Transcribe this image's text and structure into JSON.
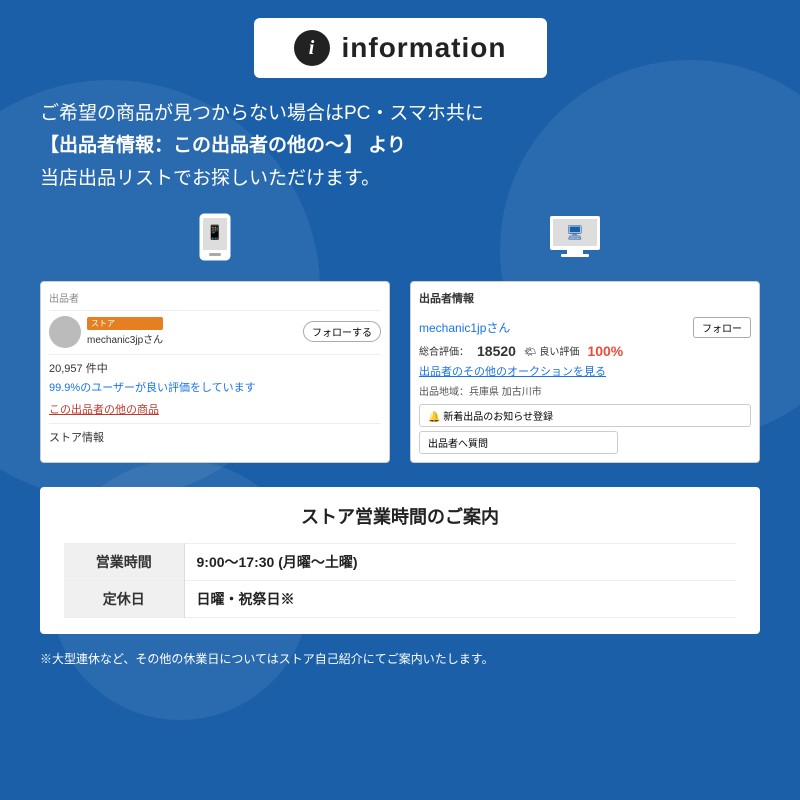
{
  "header": {
    "icon_label": "i",
    "title": "information"
  },
  "description": {
    "line1": "ご希望の商品が見つからない場合はPC・スマホ共に",
    "line2": "【出品者情報：この出品者の他の〜】 より",
    "line3": "当店出品リストでお探しいただけます。"
  },
  "mobile_screenshot": {
    "section_label": "出品者",
    "store_badge": "ストア",
    "seller_name": "mechanic3jpさん",
    "follow_button": "フォローする",
    "count": "20,957 件中",
    "rating": "99.9%のユーザーが良い評価をしています",
    "other_products": "この出品者の他の商品",
    "store_info": "ストア情報"
  },
  "pc_screenshot": {
    "section_label": "出品者情報",
    "seller_name": "mechanic1jpさん",
    "follow_button": "フォロー",
    "total_rating_label": "総合評価：",
    "total_rating_value": "18520",
    "good_rating_label": "🌤 良い評価",
    "good_rating_percent": "100%",
    "auction_link": "出品者のその他のオークションを見る",
    "location_label": "出品地域：兵庫県 加古川市",
    "notify_button": "🔔 新着出品のお知らせ登録",
    "question_button": "出品者へ質問"
  },
  "business": {
    "title": "ストア営業時間のご案内",
    "rows": [
      {
        "label": "営業時間",
        "value": "9:00〜17:30 (月曜〜土曜)"
      },
      {
        "label": "定休日",
        "value": "日曜・祝祭日※"
      }
    ]
  },
  "footnote": "※大型連休など、その他の休業日についてはストア自己紹介にてご案内いたします。"
}
